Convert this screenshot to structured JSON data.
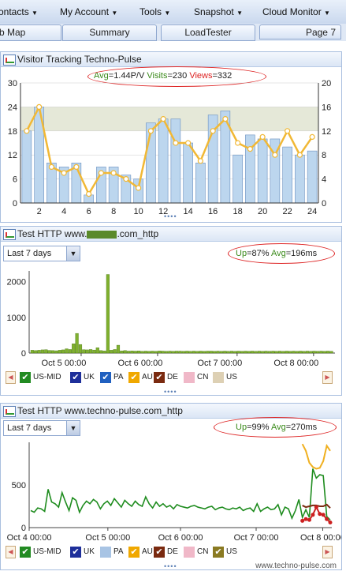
{
  "menu": [
    {
      "label": "ontacts",
      "arrow": "▼"
    },
    {
      "label": "My Account",
      "arrow": "▼"
    },
    {
      "label": "Tools",
      "arrow": "▼"
    },
    {
      "label": "Snapshot",
      "arrow": "▼"
    },
    {
      "label": "Cloud Monitor",
      "arrow": "▼"
    }
  ],
  "tabs": [
    "b Map",
    "Summary",
    "LoadTester",
    "Page 7"
  ],
  "panel1": {
    "title": "Visitor Tracking Techno-Pulse",
    "avg_label": "Avg",
    "avg_value": "=1.44P/V",
    "visits_label": "Visits",
    "visits_value": "=230",
    "views_label": "Views",
    "views_value": "=332",
    "expander": "••••"
  },
  "panel2": {
    "title_prefix": "Test HTTP www.",
    "title_suffix": ".com_http",
    "range": "Last 7 days",
    "up_label": "Up",
    "up_value": "=87%",
    "avg_label": "Avg",
    "avg_value": "=196ms",
    "legend": [
      {
        "label": "US-MID",
        "color": "#228b22",
        "checked": true
      },
      {
        "label": "UK",
        "color": "#1e2f9a",
        "checked": true
      },
      {
        "label": "PA",
        "color": "#2060c0",
        "checked": true
      },
      {
        "label": "AU",
        "color": "#f0a800",
        "checked": true
      },
      {
        "label": "DE",
        "color": "#7a2a10",
        "checked": true
      },
      {
        "label": "CN",
        "color": "#f0b8c8",
        "checked": false
      },
      {
        "label": "US",
        "color": "#ddd0b4",
        "checked": false
      }
    ],
    "expander": "••••"
  },
  "panel3": {
    "title": "Test HTTP www.techno-pulse.com_http",
    "range": "Last 7 days",
    "up_label": "Up",
    "up_value": "=99%",
    "avg_label": "Avg",
    "avg_value": "=270ms",
    "legend": [
      {
        "label": "US-MID",
        "color": "#228b22",
        "checked": true
      },
      {
        "label": "UK",
        "color": "#1e2f9a",
        "checked": true
      },
      {
        "label": "PA",
        "color": "#a8c4e4",
        "checked": false
      },
      {
        "label": "AU",
        "color": "#f0a800",
        "checked": true
      },
      {
        "label": "DE",
        "color": "#7a2a10",
        "checked": true
      },
      {
        "label": "CN",
        "color": "#f0b8c8",
        "checked": false
      },
      {
        "label": "US",
        "color": "#8a7a22",
        "checked": true
      }
    ],
    "expander": "••••"
  },
  "watermark": "www.techno-pulse.com",
  "chart_data": [
    {
      "type": "bar",
      "x": [
        1,
        2,
        3,
        4,
        5,
        6,
        7,
        8,
        9,
        10,
        11,
        12,
        13,
        14,
        15,
        16,
        17,
        18,
        19,
        20,
        21,
        22,
        23,
        24
      ],
      "x_ticks": [
        "2",
        "4",
        "6",
        "8",
        "10",
        "12",
        "14",
        "16",
        "18",
        "20",
        "22",
        "24"
      ],
      "series": [
        {
          "values": [
            18,
            24,
            10,
            9,
            10,
            2,
            9,
            9,
            7,
            6,
            20,
            21,
            21,
            15,
            10,
            22,
            23,
            12,
            17,
            16,
            16,
            14,
            12,
            13
          ]
        },
        {
          "values": [
            12,
            16,
            6,
            5,
            6,
            1.5,
            5,
            5,
            4,
            2.5,
            12,
            14,
            10,
            10,
            7,
            12,
            14,
            10,
            9,
            11,
            8,
            12,
            8,
            11
          ]
        }
      ],
      "ylim_left": [
        0,
        30
      ],
      "ylim_right": [
        0,
        20
      ],
      "yticks_left": [
        "0",
        "6",
        "12",
        "18",
        "24",
        "30"
      ],
      "yticks_right": [
        "0",
        "4",
        "8",
        "12",
        "16",
        "20"
      ],
      "colors": {
        "bar": "#bcd6ee",
        "bar_stroke": "#6a8fbf",
        "line": "#f1b835",
        "band": "#e5e8d8"
      }
    },
    {
      "type": "bar",
      "x_ticks": [
        "Oct 5 00:00",
        "Oct 6 00:00",
        "Oct 7 00:00",
        "Oct 8 00:00"
      ],
      "yticks": [
        "0",
        "1000",
        "2000"
      ],
      "ylim": [
        0,
        2300
      ],
      "series": [
        {
          "values": [
            80,
            70,
            80,
            90,
            95,
            75,
            70,
            65,
            80,
            90,
            120,
            100,
            260,
            550,
            240,
            95,
            90,
            100,
            85,
            150,
            70,
            60,
            2200,
            80,
            100,
            220,
            60,
            70,
            55,
            60,
            55,
            60,
            50,
            55,
            50,
            55,
            50,
            60,
            55,
            50,
            55,
            50,
            55,
            55,
            50,
            55,
            50,
            55,
            50,
            55,
            50,
            55,
            55,
            50,
            55,
            50,
            55,
            50,
            55,
            50,
            55,
            50,
            55,
            50,
            55,
            50,
            55,
            50,
            55,
            50,
            55,
            50,
            55,
            50,
            55,
            50,
            55,
            50,
            55,
            50,
            55,
            50,
            55,
            50,
            55,
            50,
            55,
            50
          ]
        }
      ],
      "colors": {
        "bar": "#80b030",
        "bar_stroke": "#4a7a10"
      }
    },
    {
      "type": "line",
      "x_ticks": [
        "Oct 4 00:00",
        "Oct 5 00:00",
        "Oct 6 00:00",
        "Oct 7 00:00",
        "Oct 8 00:00"
      ],
      "yticks": [
        "0",
        "500"
      ],
      "ylim": [
        0,
        1000
      ],
      "series": [
        {
          "values": [
            200,
            180,
            230,
            220,
            190,
            450,
            300,
            280,
            240,
            410,
            300,
            200,
            350,
            320,
            180,
            260,
            310,
            280,
            330,
            300,
            220,
            280,
            310,
            260,
            340,
            290,
            240,
            320,
            280,
            250,
            310,
            270,
            250,
            360,
            280,
            230,
            300,
            250,
            280,
            240,
            260,
            220,
            270,
            250,
            240,
            230,
            250,
            260,
            240,
            230,
            220,
            240,
            250,
            210,
            230,
            240,
            220,
            210,
            230,
            220,
            240,
            200,
            220,
            230,
            190,
            280,
            190,
            220,
            240,
            210,
            220,
            270,
            150,
            240,
            220,
            110,
            200,
            330,
            120,
            210,
            120,
            690,
            580,
            620,
            610,
            130,
            90
          ]
        },
        {
          "values": [
            null,
            null,
            null,
            null,
            null,
            null,
            null,
            null,
            null,
            null,
            null,
            null,
            null,
            null,
            null,
            null,
            null,
            null,
            null,
            null,
            null,
            null,
            null,
            null,
            null,
            null,
            null,
            null,
            null,
            null,
            null,
            null,
            null,
            null,
            null,
            null,
            null,
            null,
            null,
            null,
            null,
            null,
            null,
            null,
            null,
            null,
            null,
            null,
            null,
            null,
            null,
            null,
            null,
            null,
            null,
            null,
            null,
            null,
            null,
            null,
            null,
            null,
            null,
            null,
            null,
            null,
            null,
            null,
            null,
            null,
            null,
            null,
            null,
            null,
            null,
            null,
            null,
            null,
            980,
            900,
            760,
            710,
            690,
            700,
            780,
            960,
            900
          ]
        },
        {
          "values": [
            null,
            null,
            null,
            null,
            null,
            null,
            null,
            null,
            null,
            null,
            null,
            null,
            null,
            null,
            null,
            null,
            null,
            null,
            null,
            null,
            null,
            null,
            null,
            null,
            null,
            null,
            null,
            null,
            null,
            null,
            null,
            null,
            null,
            null,
            null,
            null,
            null,
            null,
            null,
            null,
            null,
            null,
            null,
            null,
            null,
            null,
            null,
            null,
            null,
            null,
            null,
            null,
            null,
            null,
            null,
            null,
            null,
            null,
            null,
            null,
            null,
            null,
            null,
            null,
            null,
            null,
            null,
            null,
            null,
            null,
            null,
            null,
            null,
            null,
            null,
            null,
            null,
            null,
            260,
            240,
            250,
            260,
            260,
            250,
            250,
            270,
            230
          ]
        },
        {
          "values": [
            null,
            null,
            null,
            null,
            null,
            null,
            null,
            null,
            null,
            null,
            null,
            null,
            null,
            null,
            null,
            null,
            null,
            null,
            null,
            null,
            null,
            null,
            null,
            null,
            null,
            null,
            null,
            null,
            null,
            null,
            null,
            null,
            null,
            null,
            null,
            null,
            null,
            null,
            null,
            null,
            null,
            null,
            null,
            null,
            null,
            null,
            null,
            null,
            null,
            null,
            null,
            null,
            null,
            null,
            null,
            null,
            null,
            null,
            null,
            null,
            null,
            null,
            null,
            null,
            null,
            null,
            null,
            null,
            null,
            null,
            null,
            null,
            null,
            null,
            null,
            null,
            null,
            null,
            80,
            100,
            90,
            150,
            240,
            160,
            150,
            100,
            60
          ]
        }
      ],
      "colors": [
        "#1e8c1e",
        "#f0b020",
        "#7a2a10",
        "#cc2020"
      ]
    }
  ]
}
